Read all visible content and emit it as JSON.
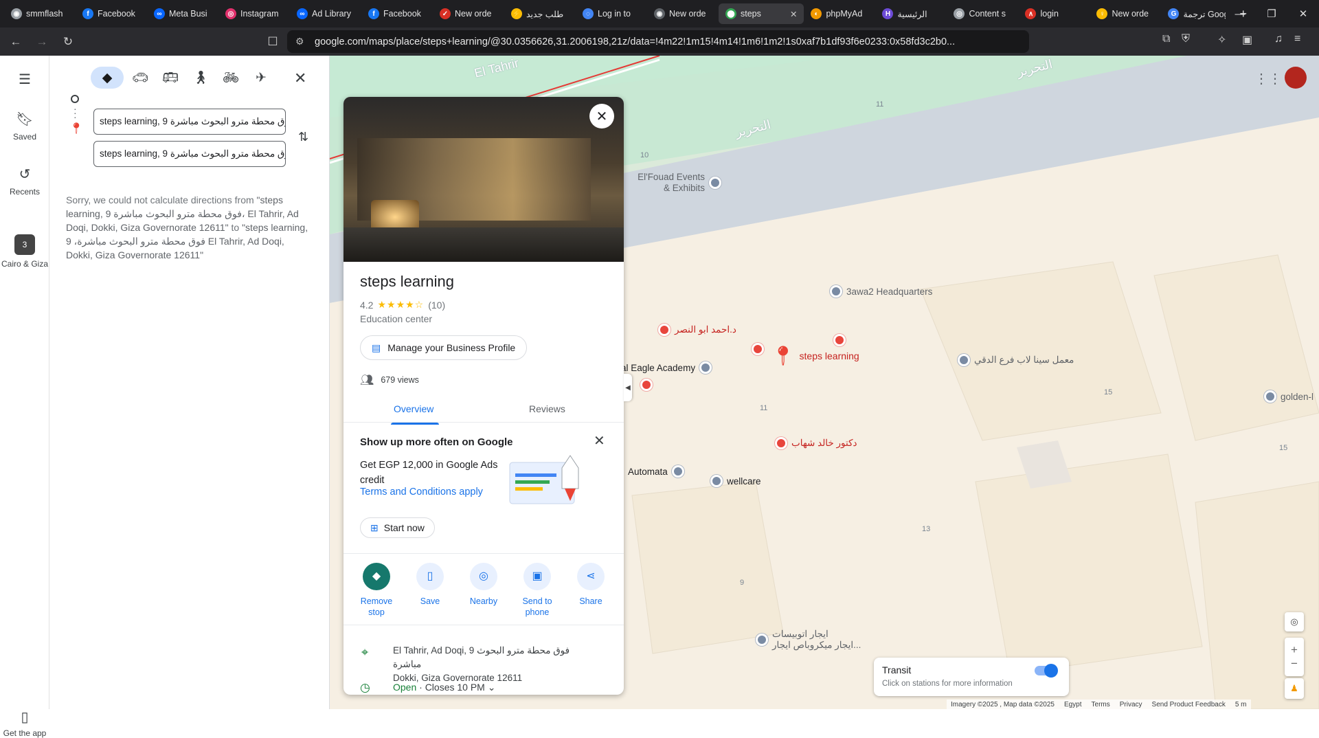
{
  "browser": {
    "tabs": [
      {
        "title": "smmflash",
        "color": "#9aa0a6",
        "glyph": "◉"
      },
      {
        "title": "Facebook",
        "color": "#1877f2",
        "glyph": "f"
      },
      {
        "title": "Meta Busi",
        "color": "#0866ff",
        "glyph": "∞"
      },
      {
        "title": "Instagram",
        "color": "#e1306c",
        "glyph": "◎"
      },
      {
        "title": "Ad Library",
        "color": "#0866ff",
        "glyph": "∞"
      },
      {
        "title": "Facebook",
        "color": "#1877f2",
        "glyph": "f"
      },
      {
        "title": "New orde",
        "color": "#d93025",
        "glyph": "✓"
      },
      {
        "title": "طلب جديد",
        "color": "#fbbc04",
        "glyph": "⚡"
      },
      {
        "title": "Log in to",
        "color": "#4285f4",
        "glyph": "◌"
      },
      {
        "title": "New orde",
        "color": "#5f6368",
        "glyph": "◉"
      },
      {
        "title": "steps",
        "color": "#34a853",
        "glyph": "⬤",
        "active": true
      },
      {
        "title": "phpMyAd",
        "color": "#f29900",
        "glyph": "◐"
      },
      {
        "title": "الرئيسية",
        "color": "#6c4bd6",
        "glyph": "H"
      },
      {
        "title": "Content s",
        "color": "#9aa0a6",
        "glyph": "◎"
      },
      {
        "title": "login",
        "color": "#d93025",
        "glyph": "∧"
      },
      {
        "title": "New orde",
        "color": "#fbbc04",
        "glyph": "♀"
      },
      {
        "title": "ترجمة Google",
        "color": "#4285f4",
        "glyph": "G"
      }
    ],
    "url": "google.com/maps/place/steps+learning/@30.0356626,31.2006198,21z/data=!4m22!1m15!4m14!1m6!1m2!1s0xaf7b1df93f6e0233:0x58fd3c2b0..."
  },
  "rail": {
    "saved": "Saved",
    "recents": "Recents",
    "recent_place": "Cairo & Giza",
    "recent_count": "3",
    "get_app": "Get the app"
  },
  "directions": {
    "origin": "steps learning, 9 فوق محطة مترو البحوث مباشرة",
    "destination": "steps learning, 9 فوق محطة مترو البحوث مباشرة",
    "error_prefix": "Sorry, we could not calculate directions from ",
    "error_from": "\"steps learning, 9 فوق محطة مترو البحوث مباشرة، El Tahrir, Ad Doqi, Dokki, Giza Governorate 12611\"",
    "error_to_word": " to ",
    "error_to": "\"steps learning, فوق محطة مترو البحوث مباشرة، 9 El Tahrir, Ad Doqi, Dokki, Giza Governorate 12611\""
  },
  "place": {
    "name": "steps learning",
    "rating": "4.2",
    "stars": "★★★★☆",
    "reviews_count": "(10)",
    "category": "Education center",
    "manage_label": "Manage your Business Profile",
    "views": "679 views",
    "tab_overview": "Overview",
    "tab_reviews": "Reviews",
    "promo_title": "Show up more often on Google",
    "promo_body": "Get EGP 12,000 in Google Ads credit",
    "promo_link": "Terms and Conditions apply",
    "start_label": "Start now",
    "actions": {
      "remove": "Remove stop",
      "save": "Save",
      "nearby": "Nearby",
      "send": "Send to phone",
      "share": "Share"
    },
    "address_line1": "El Tahrir, Ad Doqi, 9 فوق محطة مترو البحوث مباشرة",
    "address_line2": "Dokki, Giza Governorate 12611",
    "hours_open": "Open",
    "hours_rest": " · Closes 10 PM"
  },
  "map": {
    "pois": {
      "fouad": "El'Fouad Events & Exhibits",
      "sawa2": "3awa2 Headquarters",
      "ahmed": "د.احمد ابو النصر",
      "eagle": "al Eagle Academy",
      "steps": "steps learning",
      "lab": "معمل سينا لاب فرع الدقي",
      "khaled": "دكتور خالد شهاب",
      "automata": "Automata",
      "wellcare": "wellcare",
      "golden": "golden-l",
      "bus1": "ايجار اتوبيسات",
      "bus2": "ايجار ميكروباص ايجار..."
    },
    "streets": {
      "tahrir_en": "El Tahrir",
      "tahrir_ar1": "التحرير",
      "tahrir_ar2": "التحرير"
    },
    "numbers": [
      "11",
      "10",
      "11",
      "15",
      "15",
      "13",
      "9"
    ],
    "transit_title": "Transit",
    "transit_sub": "Click on stations for more information",
    "footer": [
      "Imagery ©2025 , Map data ©2025",
      "Egypt",
      "Terms",
      "Privacy",
      "Send Product Feedback",
      "5 m"
    ]
  }
}
